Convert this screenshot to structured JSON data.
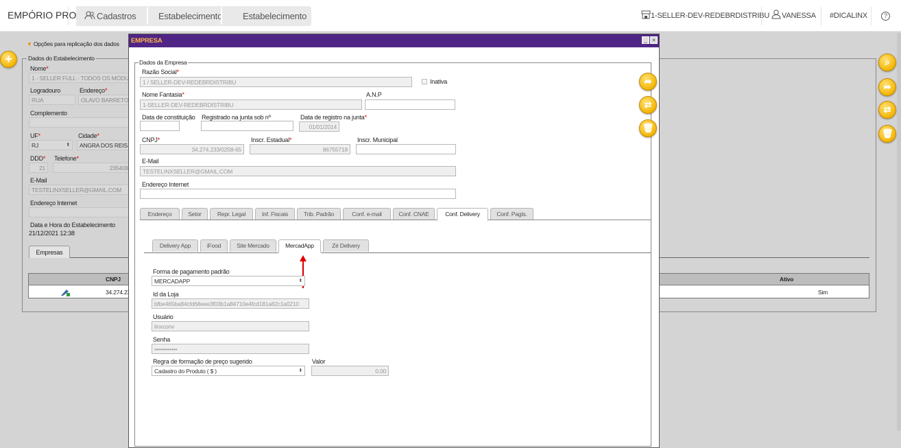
{
  "app": {
    "title": "EMPÓRIO PRO"
  },
  "breadcrumb": [
    "Cadastros",
    "Estabelecimento",
    "Estabelecimento"
  ],
  "topbar_right": {
    "store": "1-SELLER-DEV-REDEBRDISTRIBU",
    "user": "VANESSA",
    "hashtag": "#DICALINX",
    "help": "?"
  },
  "background": {
    "replication_toggle": "Opções para replicação dos dados",
    "legend": "Dados do Estabelecimento",
    "nome_label": "Nome",
    "nome_value": "1 - SELLER FULL - TODOS OS MÓDU",
    "logradouro_label": "Logradouro",
    "logradouro_value": "RUA",
    "endereco_label": "Endereço",
    "endereco_value": "OLAVO BARRETO",
    "complemento_label": "Complemento",
    "uf_label": "UF",
    "uf_value": "RJ",
    "cidade_label": "Cidade",
    "cidade_value": "ANGRA DOS REIS",
    "ddd_label": "DDD",
    "ddd_value": "21",
    "telefone_label": "Telefone",
    "telefone_value": "235408",
    "email_label": "E-Mail",
    "email_value": "TESTELINXSELLER@GMAIL.COM",
    "endereco_internet_label": "Endereço Internet",
    "datahora_label": "Data e Hora do Estabelecimento",
    "datahora_value": "21/12/2021 12:38",
    "tab_empresas": "Empresas",
    "table": {
      "col_cnpj": "CNPJ",
      "col_ativo": "Ativo",
      "row_cnpj": "34.274.23",
      "row_ativo": "Sim"
    }
  },
  "modal": {
    "title": "EMPRESA",
    "fieldset_legend": "Dados da Empresa",
    "razao_social_label": "Razão Social",
    "razao_social_value": "1 / SELLER-DEV-REDEBRDISTRIBU",
    "inativa_label": "Inativa",
    "nome_fantasia_label": "Nome Fantasia",
    "nome_fantasia_value": "1-SELLER-DEV-REDEBRDISTRIBU",
    "anp_label": "A.N.P",
    "data_constituicao_label": "Data de constituição",
    "registrado_junta_label": "Registrado na junta sob nº",
    "data_registro_junta_label": "Data de registro na junta",
    "data_registro_junta_value": "01/01/2014",
    "cnpj_label": "CNPJ",
    "cnpj_value": "34.274.233/0258-65",
    "insc_estadual_label": "Inscr. Estadual",
    "insc_estadual_value": "86755718",
    "insc_municipal_label": "Inscr. Municipal",
    "email_label": "E-Mail",
    "email_value": "TESTELINXSELLER@GMAIL.COM",
    "endereco_internet_label": "Endereço Internet",
    "tabs": [
      "Endereço",
      "Setor",
      "Repr. Legal",
      "Inf. Fiscais",
      "Trib. Padrão",
      "Conf. e-mail",
      "Conf. CNAE",
      "Conf. Delivery",
      "Conf. Pagts."
    ],
    "subtabs": [
      "Delivery App",
      "iFood",
      "Site Mercado",
      "MercadApp",
      "Zé Delivery"
    ],
    "forma_pagamento_label": "Forma de pagamento padrão",
    "forma_pagamento_value": "MERCADAPP",
    "id_loja_label": "Id da Loja",
    "id_loja_value": "bfbe465ba84cfd68eee3f03b1a84710e4fcd181a82c1a0210",
    "usuario_label": "Usuário",
    "usuario_value": "linxconv",
    "senha_label": "Senha",
    "senha_value": "••••••••••••",
    "regra_preco_label": "Regra de formação de preço sugerido",
    "regra_preco_value": "Cadastro do Produto ( $ )",
    "valor_label": "Valor",
    "valor_value": "0,00"
  },
  "colors": {
    "accent": "#4f2585",
    "title_text": "#ffb547",
    "button": "#f5b90c",
    "required": "#e10000",
    "annotation_arrow": "#e00000"
  }
}
